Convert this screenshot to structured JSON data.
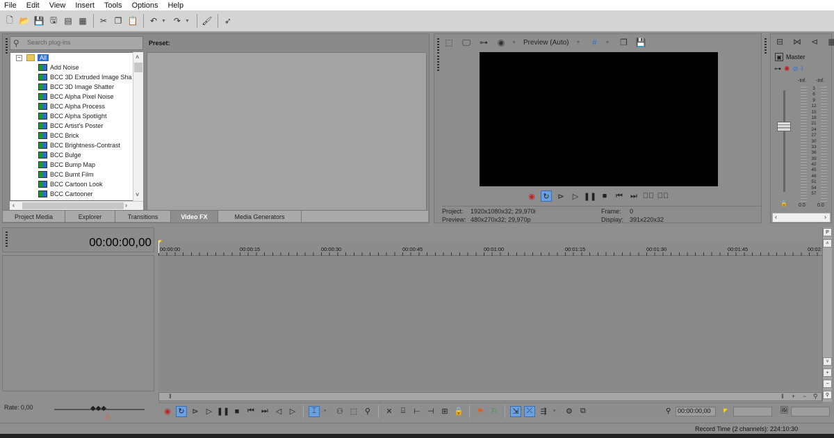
{
  "menu": [
    "File",
    "Edit",
    "View",
    "Insert",
    "Tools",
    "Options",
    "Help"
  ],
  "plugins": {
    "search_placeholder": "Search plug-ins",
    "root_label": "All",
    "items": [
      "Add Noise",
      "BCC 3D Extruded Image Sha",
      "BCC 3D Image Shatter",
      "BCC Alpha Pixel Noise",
      "BCC Alpha Process",
      "BCC Alpha Spotlight",
      "BCC Artist's Poster",
      "BCC Brick",
      "BCC Brightness-Contrast",
      "BCC Bulge",
      "BCC Bump Map",
      "BCC Burnt Film",
      "BCC Cartoon Look",
      "BCC Cartooner"
    ],
    "preset_label": "Preset:"
  },
  "tabs": [
    "Project Media",
    "Explorer",
    "Transitions",
    "Video FX",
    "Media Generators"
  ],
  "active_tab": "Video FX",
  "preview": {
    "mode_label": "Preview (Auto)",
    "project_label": "Project:",
    "project_value": "1920x1080x32; 29,970i",
    "preview_label": "Preview:",
    "preview_value": "480x270x32; 29,970p",
    "frame_label": "Frame:",
    "frame_value": "0",
    "display_label": "Display:",
    "display_value": "391x220x32"
  },
  "master": {
    "label": "Master",
    "left_peak": "-Inf.",
    "right_peak": "-Inf.",
    "scale": [
      "3",
      "6",
      "9",
      "12",
      "15",
      "18",
      "21",
      "24",
      "27",
      "30",
      "33",
      "36",
      "39",
      "42",
      "45",
      "48",
      "51",
      "54",
      "57"
    ],
    "left_level": "0.0",
    "right_level": "0.0"
  },
  "timeline": {
    "timecode": "00:00:00,00",
    "ruler": [
      "00:00:00",
      "00:00:15",
      "00:00:30",
      "00:00:45",
      "00:01:00",
      "00:01:15",
      "00:01:30",
      "00:01:45",
      "00:02:00"
    ],
    "rate": "Rate: 0,00",
    "cursor_time": "00:00:00,00",
    "record_time": "Record Time (2 channels): 224:10:30"
  },
  "colors": {
    "accent": "#2e6fd6",
    "record": "#c02020",
    "screen": "#000000"
  }
}
